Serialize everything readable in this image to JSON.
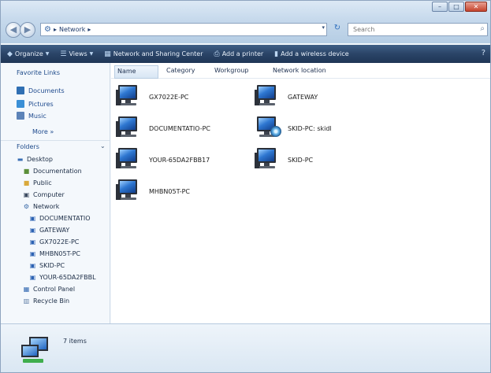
{
  "window": {
    "caption_buttons": [
      "–",
      "□",
      "✕"
    ]
  },
  "navigation": {
    "back_glyph": "◀",
    "forward_glyph": "▶",
    "address_crumbs": [
      "▸",
      "Network",
      "▸"
    ],
    "address_icon": "network-icon",
    "refresh_icon": "refresh-icon",
    "refresh_glyph": "↻",
    "dropdown_glyph": "▾",
    "search_placeholder": "Search",
    "search_glyph": "⌕"
  },
  "commandbar": {
    "items": [
      {
        "label": "Organize",
        "icon": "organize-icon"
      },
      {
        "label": "Views",
        "icon": "views-icon"
      },
      {
        "label": "Network and Sharing Center",
        "icon": "sharing-center-icon"
      },
      {
        "label": "Add a printer",
        "icon": "printer-icon"
      },
      {
        "label": "Add a wireless device",
        "icon": "wireless-icon"
      }
    ],
    "help_glyph": "?"
  },
  "sidebar": {
    "favorites_title": "Favorite Links",
    "favorites": [
      {
        "label": "Documents",
        "color": "#2f6fb3"
      },
      {
        "label": "Pictures",
        "color": "#3a8fd6"
      },
      {
        "label": "Music",
        "color": "#5c83b8"
      }
    ],
    "more_label": "More »",
    "folders_title": "Folders",
    "folders_chevron": "⌄",
    "tree": [
      {
        "label": "Desktop",
        "glyph": "▬",
        "color": "#3a6fb5"
      },
      {
        "label": "Documentation",
        "glyph": "■",
        "color": "#5b8f3a"
      },
      {
        "label": "Public",
        "glyph": "■",
        "color": "#d9a93c"
      },
      {
        "label": "Computer",
        "glyph": "▣",
        "color": "#3b4a60"
      },
      {
        "label": "Network",
        "glyph": "⚙",
        "color": "#3a6aa8"
      },
      {
        "label": "DOCUMENTATIO",
        "glyph": "▣",
        "color": "#2c62b3"
      },
      {
        "label": "GATEWAY",
        "glyph": "▣",
        "color": "#2c62b3"
      },
      {
        "label": "GX7022E-PC",
        "glyph": "▣",
        "color": "#2c62b3"
      },
      {
        "label": "MHBN05T-PC",
        "glyph": "▣",
        "color": "#2c62b3"
      },
      {
        "label": "SKID-PC",
        "glyph": "▣",
        "color": "#2c62b3"
      },
      {
        "label": "YOUR-65DA2FBBL",
        "glyph": "▣",
        "color": "#2c62b3"
      },
      {
        "label": "Control Panel",
        "glyph": "▦",
        "color": "#2f66b0"
      },
      {
        "label": "Recycle Bin",
        "glyph": "▥",
        "color": "#5f7ea6"
      }
    ]
  },
  "content": {
    "columns": [
      "Name",
      "Category",
      "Workgroup",
      "Network location"
    ],
    "items": [
      {
        "label": "GX7022E-PC",
        "type": "computer"
      },
      {
        "label": "GATEWAY",
        "type": "computer"
      },
      {
        "label": "DOCUMENTATIO-PC",
        "type": "computer"
      },
      {
        "label": "SKID-PC: skidl",
        "type": "media-device"
      },
      {
        "label": "YOUR-65DA2FBB17",
        "type": "computer"
      },
      {
        "label": "SKID-PC",
        "type": "computer"
      },
      {
        "label": "MHBN05T-PC",
        "type": "computer"
      }
    ]
  },
  "details": {
    "count": "7 items"
  }
}
